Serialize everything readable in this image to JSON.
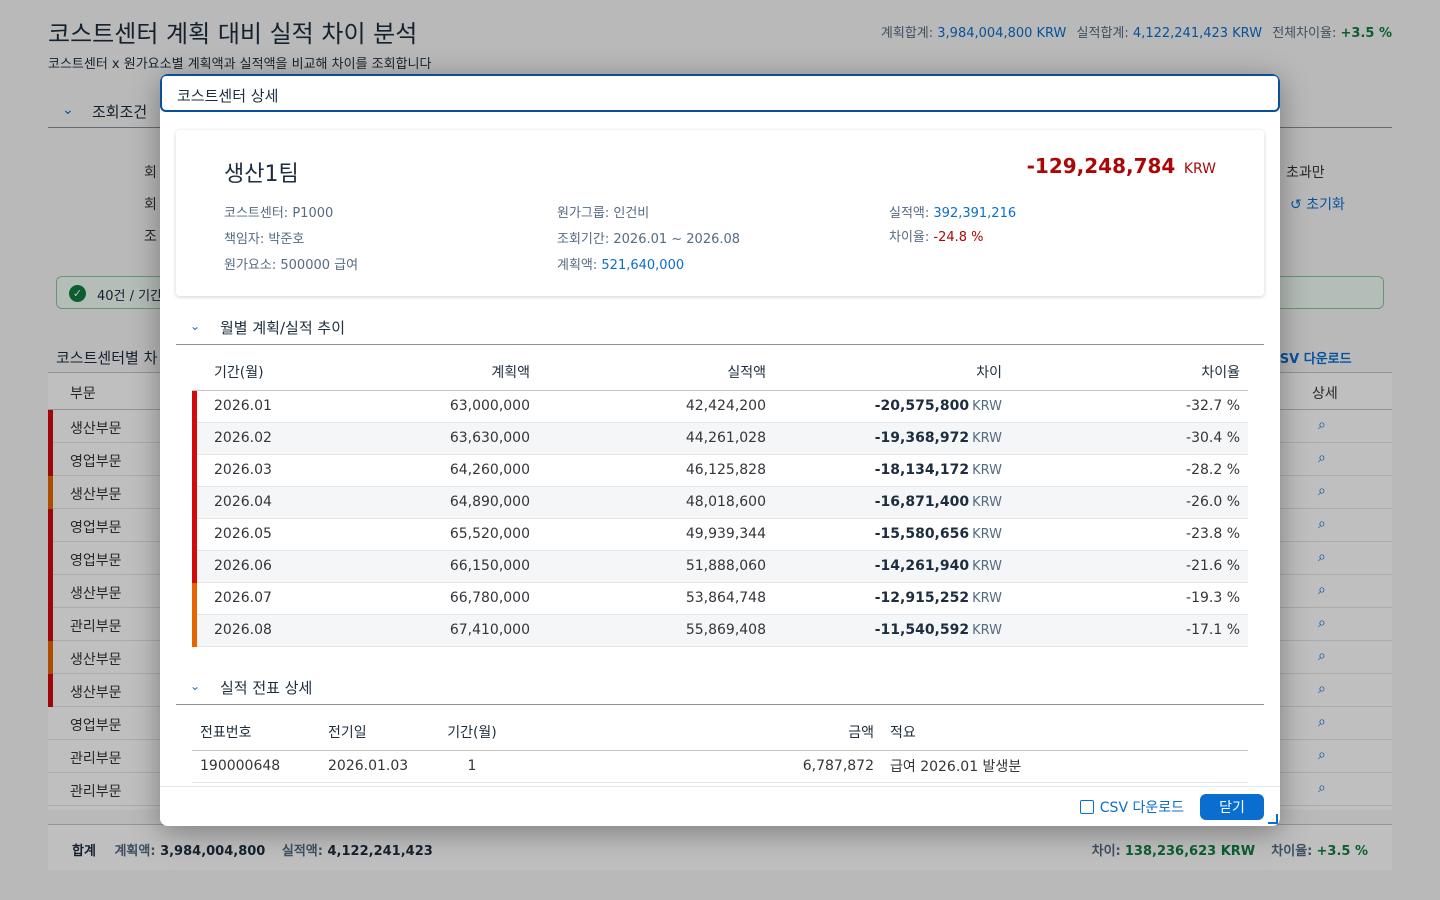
{
  "page": {
    "title": "코스트센터 계획 대비 실적 차이 분석",
    "subtitle": "코스트센터 x 원가요소별 계획액과 실적액을 비교해 차이를 조회합니다",
    "summary": {
      "plan_label": "계획합계:",
      "plan_value": "3,984,004,800 KRW",
      "actual_label": "실적합계:",
      "actual_value": "4,122,241,423 KRW",
      "variance_label": "전체차이율:",
      "variance_value": "+3.5 %"
    },
    "filter": {
      "label": "조회조건",
      "row_labels": [
        "회",
        "회",
        "조"
      ],
      "right_label": "초과만",
      "reset_label": "초기화"
    },
    "status_text": "40건 / 기간",
    "table": {
      "title": "코스트센터별 차",
      "csv_label": "CSV 다운로드",
      "col_dept": "부문",
      "col_detail": "상세",
      "rows": [
        {
          "dept": "생산부문",
          "color": "#d20a0a"
        },
        {
          "dept": "영업부문",
          "color": "#d20a0a"
        },
        {
          "dept": "생산부문",
          "color": "#e76500"
        },
        {
          "dept": "영업부문",
          "color": "#d20a0a"
        },
        {
          "dept": "영업부문",
          "color": "#d20a0a"
        },
        {
          "dept": "생산부문",
          "color": "#d20a0a"
        },
        {
          "dept": "관리부문",
          "color": "#d20a0a"
        },
        {
          "dept": "생산부문",
          "color": "#e76500"
        },
        {
          "dept": "생산부문",
          "color": "#d20a0a"
        },
        {
          "dept": "영업부문",
          "color": ""
        },
        {
          "dept": "관리부문",
          "color": ""
        },
        {
          "dept": "관리부문",
          "color": ""
        }
      ]
    },
    "totals": {
      "label": "합계",
      "plan_label": "계획액:",
      "plan_value": "3,984,004,800",
      "actual_label": "실적액:",
      "actual_value": "4,122,241,423",
      "diff_label": "차이:",
      "diff_value": "138,236,623 KRW",
      "rate_label": "차이율:",
      "rate_value": "+3.5 %"
    }
  },
  "dialog": {
    "title": "코스트센터 상세",
    "header": {
      "name": "생산1팀",
      "kpi_value": "-129,248,784",
      "kpi_unit": "KRW",
      "cost_center_label": "코스트센터:",
      "cost_center_value": "P1000",
      "owner_label": "책임자:",
      "owner_value": "박준호",
      "cost_element_label": "원가요소:",
      "cost_element_value": "500000 급여",
      "cost_group_label": "원가그룹:",
      "cost_group_value": "인건비",
      "period_label": "조회기간:",
      "period_value": "2026.01 ~ 2026.08",
      "plan_label": "계획액:",
      "plan_value": "521,640,000",
      "actual_label": "실적액:",
      "actual_value": "392,391,216",
      "rate_label": "차이율:",
      "rate_value": "-24.8 %"
    },
    "monthly": {
      "section_title": "월별 계획/실적 추이",
      "columns": [
        "기간(월)",
        "계획액",
        "실적액",
        "차이",
        "차이율"
      ],
      "unit": "KRW",
      "rows": [
        {
          "period": "2026.01",
          "plan": "63,000,000",
          "actual": "42,424,200",
          "diff": "-20,575,800",
          "rate": "-32.7 %",
          "color": "#d20a0a"
        },
        {
          "period": "2026.02",
          "plan": "63,630,000",
          "actual": "44,261,028",
          "diff": "-19,368,972",
          "rate": "-30.4 %",
          "color": "#d20a0a"
        },
        {
          "period": "2026.03",
          "plan": "64,260,000",
          "actual": "46,125,828",
          "diff": "-18,134,172",
          "rate": "-28.2 %",
          "color": "#d20a0a"
        },
        {
          "period": "2026.04",
          "plan": "64,890,000",
          "actual": "48,018,600",
          "diff": "-16,871,400",
          "rate": "-26.0 %",
          "color": "#d20a0a"
        },
        {
          "period": "2026.05",
          "plan": "65,520,000",
          "actual": "49,939,344",
          "diff": "-15,580,656",
          "rate": "-23.8 %",
          "color": "#d20a0a"
        },
        {
          "period": "2026.06",
          "plan": "66,150,000",
          "actual": "51,888,060",
          "diff": "-14,261,940",
          "rate": "-21.6 %",
          "color": "#d20a0a"
        },
        {
          "period": "2026.07",
          "plan": "66,780,000",
          "actual": "53,864,748",
          "diff": "-12,915,252",
          "rate": "-19.3 %",
          "color": "#e76500"
        },
        {
          "period": "2026.08",
          "plan": "67,410,000",
          "actual": "55,869,408",
          "diff": "-11,540,592",
          "rate": "-17.1 %",
          "color": "#e76500"
        }
      ]
    },
    "docs": {
      "section_title": "실적 전표 상세",
      "columns": [
        "전표번호",
        "전기일",
        "기간(월)",
        "금액",
        "적요"
      ],
      "rows": [
        {
          "doc_no": "190000648",
          "date": "2026.01.03",
          "period": "1",
          "amount": "6,787,872",
          "text": "급여 2026.01 발생분"
        }
      ]
    },
    "footer": {
      "csv_label": "CSV 다운로드",
      "close_label": "닫기"
    }
  }
}
